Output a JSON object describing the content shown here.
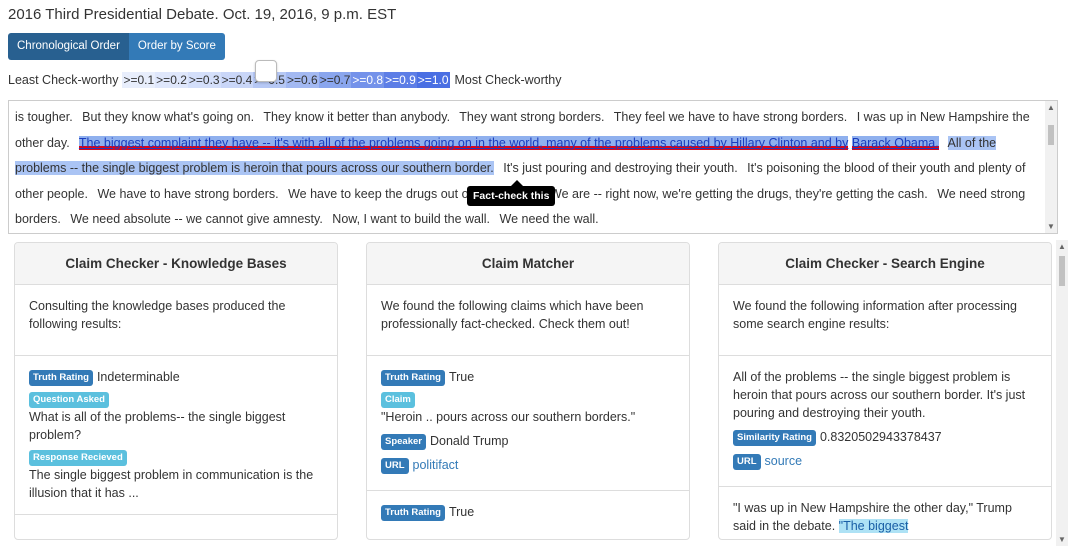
{
  "page": {
    "title": "2016 Third Presidential Debate. Oct. 19, 2016, 9 p.m. EST"
  },
  "sort_buttons": {
    "chronological": "Chronological Order",
    "by_score": "Order by Score"
  },
  "scale": {
    "left_label": "Least Check-worthy",
    "right_label": "Most Check-worthy",
    "segments": [
      {
        "text": ">=0.1",
        "color": "#e8eefc"
      },
      {
        "text": ">=0.2",
        "color": "#dfe7fb"
      },
      {
        "text": ">=0.3",
        "color": "#d4dffa"
      },
      {
        "text": ">=0.4",
        "color": "#c9d6f8"
      },
      {
        "text": ">=0.5",
        "color": "#b6c8f5"
      },
      {
        "text": ">=0.6",
        "color": "#a3b9f2"
      },
      {
        "text": ">=0.7",
        "color": "#8aa6ee"
      },
      {
        "text": ">=0.8",
        "color": "#7492ea"
      },
      {
        "text": ">=0.9",
        "color": "#5d7ee6"
      },
      {
        "text": ">=1.0",
        "color": "#4a6fe3"
      }
    ]
  },
  "transcript": {
    "s1": "is tougher.",
    "s2": "But they know what's going on.",
    "s3": "They know it better than anybody.",
    "s4": "They want strong borders.",
    "s5": "They feel we have to have strong borders.",
    "s6": "I was up in New Hampshire the other day.",
    "s7a": "The biggest complaint they have -- it's with all of the problems going on in the world, many of the problems caused by Hillary Clinton and by",
    "s7b": "Barack Obama.",
    "s8": "All of the problems -- the single biggest problem is heroin that pours across our southern border.",
    "s9": "It's just pouring and destroying their youth.",
    "s10": "It's poisoning the blood of their youth and plenty of other people.",
    "s11": "We have to have strong borders.",
    "s12": "We have to keep the drugs out of our country.",
    "s13": "We are -- right now, we're getting the drugs, they're getting the cash.",
    "s14": "We need strong borders.",
    "s15": "We need absolute -- we cannot give amnesty.",
    "s16": "Now, I want to build the wall.",
    "s17": "We need the wall.",
    "tooltip": "Fact-check this"
  },
  "panels": {
    "kb": {
      "heading": "Claim Checker - Knowledge Bases",
      "intro": "Consulting the knowledge bases produced the following results:",
      "truth_label": "Truth Rating",
      "truth_value": "Indeterminable",
      "question_label": "Question Asked",
      "question_value": "What is all of the problems-- the single biggest problem?",
      "response_label": "Response Recieved",
      "response_value": "The single biggest problem in communication is the illusion that it has ..."
    },
    "matcher": {
      "heading": "Claim Matcher",
      "intro": "We found the following claims which have been professionally fact-checked. Check them out!",
      "truth_label": "Truth Rating",
      "truth_value": "True",
      "claim_label": "Claim",
      "claim_value": "\"Heroin .. pours across our southern borders.\"",
      "speaker_label": "Speaker",
      "speaker_value": "Donald Trump",
      "url_label": "URL",
      "url_value": "politifact",
      "truth2_label": "Truth Rating",
      "truth2_value": "True"
    },
    "search": {
      "heading": "Claim Checker - Search Engine",
      "intro": "We found the following information after processing some search engine results:",
      "result_text": "All of the problems -- the single biggest problem is heroin that pours across our southern border. It's just pouring and destroying their youth.",
      "similarity_label": "Similarity Rating",
      "similarity_value": "0.8320502943378437",
      "url_label": "URL",
      "url_value": "source",
      "quote_text": "\"I was up in New Hampshire the other day,\" Trump said in the debate.",
      "quote_hl": "\"The biggest"
    }
  }
}
